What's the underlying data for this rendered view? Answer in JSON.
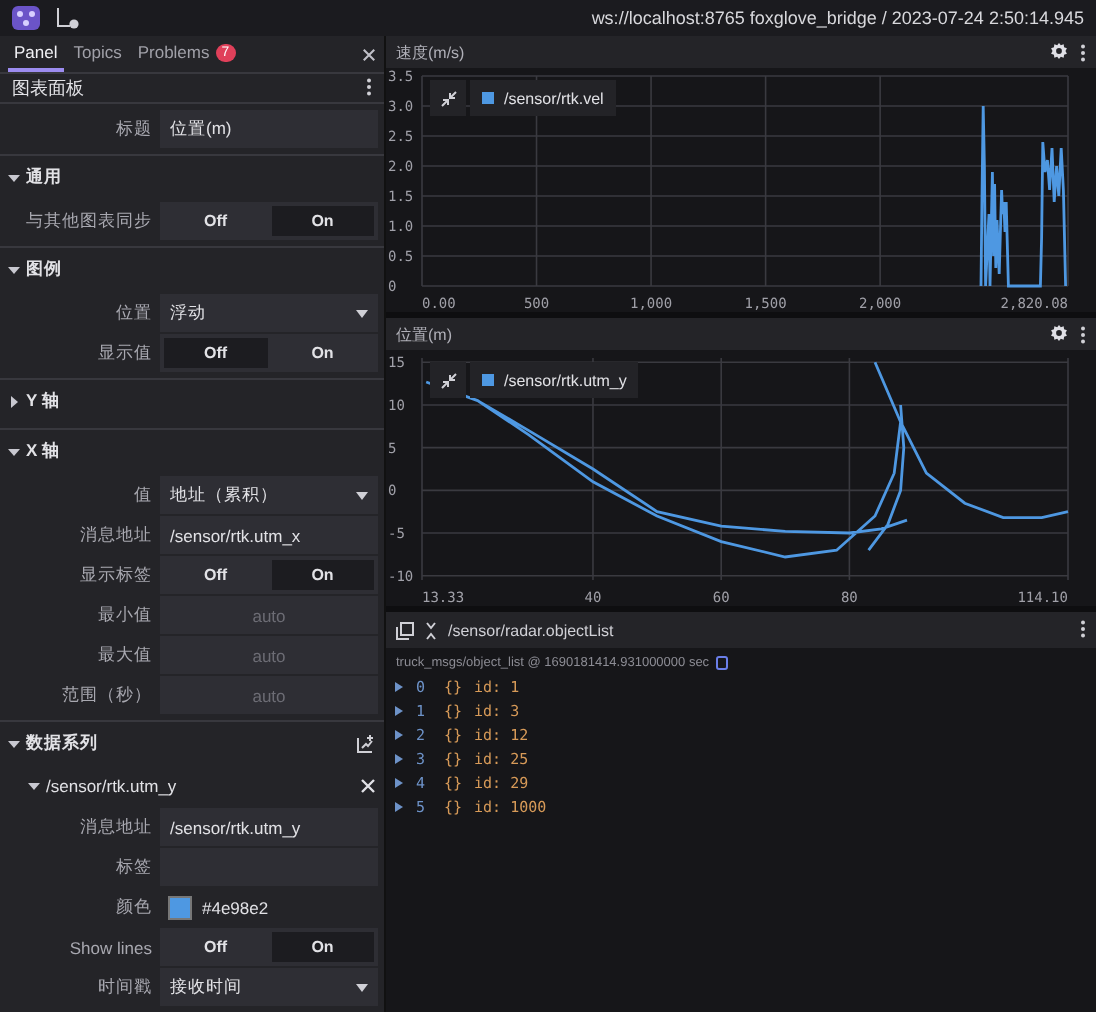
{
  "app_bar": {
    "connection": "ws://localhost:8765 foxglove_bridge / 2023-07-24 2:50:14.945"
  },
  "sidebar": {
    "tabs": [
      {
        "label": "Panel",
        "selected": true
      },
      {
        "label": "Topics",
        "selected": false
      },
      {
        "label": "Problems",
        "selected": false,
        "badge": "7"
      }
    ],
    "panel_title": "图表面板",
    "rows": [
      {
        "kind": "text",
        "label": "标题",
        "value": "位置(m)"
      }
    ],
    "sections": [
      {
        "kind": "group",
        "title": "通用",
        "expanded": true,
        "rows": [
          {
            "kind": "toggle",
            "label": "与其他图表同步",
            "options": [
              {
                "label": "Off",
                "selected": false
              },
              {
                "label": "On",
                "selected": true
              }
            ]
          }
        ]
      },
      {
        "kind": "group",
        "title": "图例",
        "expanded": true,
        "rows": [
          {
            "kind": "select",
            "label": "位置",
            "value": "浮动"
          },
          {
            "kind": "toggle",
            "label": "显示值",
            "options": [
              {
                "label": "Off",
                "selected": true
              },
              {
                "label": "On",
                "selected": false
              }
            ]
          }
        ]
      },
      {
        "kind": "group",
        "title": "Y 轴",
        "expanded": false
      },
      {
        "kind": "group",
        "title": "X 轴",
        "expanded": true,
        "rows": [
          {
            "kind": "select",
            "label": "值",
            "value": "地址（累积）"
          },
          {
            "kind": "text",
            "label": "消息地址",
            "value": "/sensor/rtk.utm_x"
          },
          {
            "kind": "toggle",
            "label": "显示标签",
            "options": [
              {
                "label": "Off",
                "selected": false
              },
              {
                "label": "On",
                "selected": true
              }
            ]
          },
          {
            "kind": "text",
            "label": "最小值",
            "placeholder": "auto"
          },
          {
            "kind": "text",
            "label": "最大值",
            "placeholder": "auto"
          },
          {
            "kind": "text",
            "label": "范围（秒）",
            "placeholder": "auto"
          }
        ]
      },
      {
        "kind": "series",
        "title": "数据系列",
        "expanded": true,
        "series": [
          {
            "title": "/sensor/rtk.utm_y",
            "expanded": true,
            "rows": [
              {
                "kind": "text",
                "label": "消息地址",
                "value": "/sensor/rtk.utm_y"
              },
              {
                "kind": "text",
                "label": "标签"
              },
              {
                "kind": "color",
                "label": "颜色",
                "value": "#4e98e2",
                "color": "#4e98e2"
              },
              {
                "kind": "toggle",
                "label": "Show lines",
                "options": [
                  {
                    "label": "Off",
                    "selected": false
                  },
                  {
                    "label": "On",
                    "selected": true
                  }
                ]
              },
              {
                "kind": "select",
                "label": "时间戳",
                "value": "接收时间"
              }
            ]
          }
        ]
      }
    ]
  },
  "charts": [
    {
      "title": "速度(m/s)",
      "chart_data": {
        "type": "line",
        "grid": true,
        "x": [
          2440,
          2445,
          2450,
          2455,
          2460,
          2470,
          2475,
          2480,
          2490,
          2495,
          2500,
          2505,
          2510,
          2520,
          2530,
          2535,
          2540,
          2545,
          2550,
          2560,
          2600,
          2650,
          2700,
          2705,
          2710,
          2720,
          2730,
          2740,
          2750,
          2760,
          2770,
          2780,
          2790,
          2800,
          2810
        ],
        "series": [
          {
            "name": "/sensor/rtk.vel",
            "color": "#4e98e2",
            "values": [
              0,
              1.5,
              3.0,
              2.0,
              0,
              0.8,
              1.2,
              0,
              1.9,
              0.5,
              1.7,
              0.3,
              1.1,
              0.2,
              1.6,
              1.2,
              1.4,
              0.9,
              1.4,
              0,
              0,
              0,
              0,
              0.8,
              2.4,
              1.9,
              2.1,
              1.6,
              2.3,
              1.4,
              2.0,
              1.5,
              2.3,
              1.6,
              0
            ]
          }
        ],
        "xlim": [
          0,
          2820.08
        ],
        "ylim": [
          0,
          3.5
        ],
        "xticks": [
          {
            "value": 0,
            "label": "0.00"
          },
          {
            "value": 500,
            "label": "500"
          },
          {
            "value": 1000,
            "label": "1,000"
          },
          {
            "value": 1500,
            "label": "1,500"
          },
          {
            "value": 2000,
            "label": "2,000"
          },
          {
            "value": 2820.08,
            "label": "2,820.08"
          }
        ],
        "yticks": [
          {
            "value": 0,
            "label": "0"
          },
          {
            "value": 0.5,
            "label": "0.5"
          },
          {
            "value": 1,
            "label": "1.0"
          },
          {
            "value": 1.5,
            "label": "1.5"
          },
          {
            "value": 2,
            "label": "2.0"
          },
          {
            "value": 2.5,
            "label": "2.5"
          },
          {
            "value": 3,
            "label": "3.0"
          },
          {
            "value": 3.5,
            "label": "3.5"
          }
        ]
      }
    },
    {
      "title": "位置(m)",
      "chart_data": {
        "type": "line",
        "grid": true,
        "x": [
          14,
          22,
          30,
          40,
          50,
          60,
          70,
          78,
          84,
          87,
          88,
          null,
          22,
          30,
          40,
          50,
          60,
          70,
          80,
          85,
          89,
          null,
          83,
          86,
          88,
          88.5,
          88,
          null,
          84,
          88,
          92,
          98,
          104,
          110,
          114.1
        ],
        "series": [
          {
            "name": "/sensor/rtk.utm_y",
            "color": "#4e98e2",
            "values": [
              12.7,
              10.5,
              6.5,
              1,
              -3,
              -6,
              -7.8,
              -7,
              -3,
              2,
              8,
              null,
              10.5,
              7,
              2.5,
              -2.5,
              -4.2,
              -4.8,
              -5,
              -4.5,
              -3.5,
              null,
              -7,
              -4,
              0,
              5,
              10,
              null,
              15,
              8,
              2,
              -1.5,
              -3.2,
              -3.2,
              -2.5
            ]
          }
        ],
        "xlim": [
          13.33,
          114.1
        ],
        "ylim": [
          -10.5,
          15.5
        ],
        "xticks": [
          {
            "value": 13.33,
            "label": "13.33"
          },
          40,
          60,
          80,
          {
            "value": 114.1,
            "label": "114.10"
          }
        ],
        "yticks": [
          -10,
          -5,
          0,
          5,
          10,
          15
        ]
      }
    }
  ],
  "raw_messages": {
    "topic": "/sensor/radar.objectList",
    "schema": "truck_msgs/object_list @ 1690181414.931000000 sec",
    "items": [
      {
        "index": "0",
        "glyph": "{}",
        "text": "id: 1",
        "expanded": false
      },
      {
        "index": "1",
        "glyph": "{}",
        "text": "id: 3",
        "expanded": false
      },
      {
        "index": "2",
        "glyph": "{}",
        "text": "id: 12",
        "expanded": false
      },
      {
        "index": "3",
        "glyph": "{}",
        "text": "id: 25",
        "expanded": false
      },
      {
        "index": "4",
        "glyph": "{}",
        "text": "id: 29",
        "expanded": false
      },
      {
        "index": "5",
        "glyph": "{}",
        "text": "id: 1000",
        "expanded": false
      }
    ]
  }
}
